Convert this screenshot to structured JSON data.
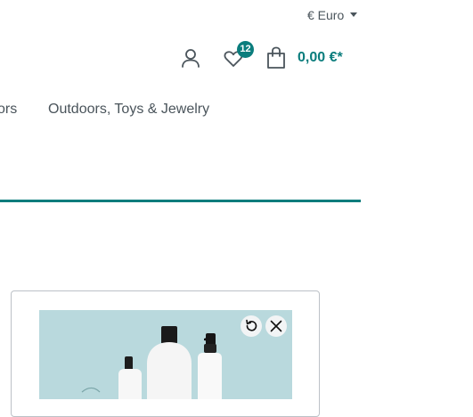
{
  "header": {
    "currency": {
      "label": "€ Euro",
      "icon": "caret-down-icon"
    },
    "account": {
      "icon": "user-icon"
    },
    "wishlist": {
      "icon": "heart-icon",
      "count": "12"
    },
    "cart": {
      "icon": "shopping-bag-icon",
      "total": "0,00 €*"
    }
  },
  "nav": {
    "items": [
      {
        "label": "ors"
      },
      {
        "label": "Outdoors, Toys & Jewelry"
      }
    ],
    "accent_color": "#0b7d7d"
  },
  "card": {
    "image": {
      "subject": "cosmetic bottles on light blue background"
    },
    "controls": {
      "reset_icon": "rotate-left-icon",
      "close_icon": "close-icon"
    }
  },
  "colors": {
    "accent": "#0b7d7d",
    "text": "#4a545b",
    "border": "#bcc1c7",
    "image_bg": "#b9d9dd"
  }
}
